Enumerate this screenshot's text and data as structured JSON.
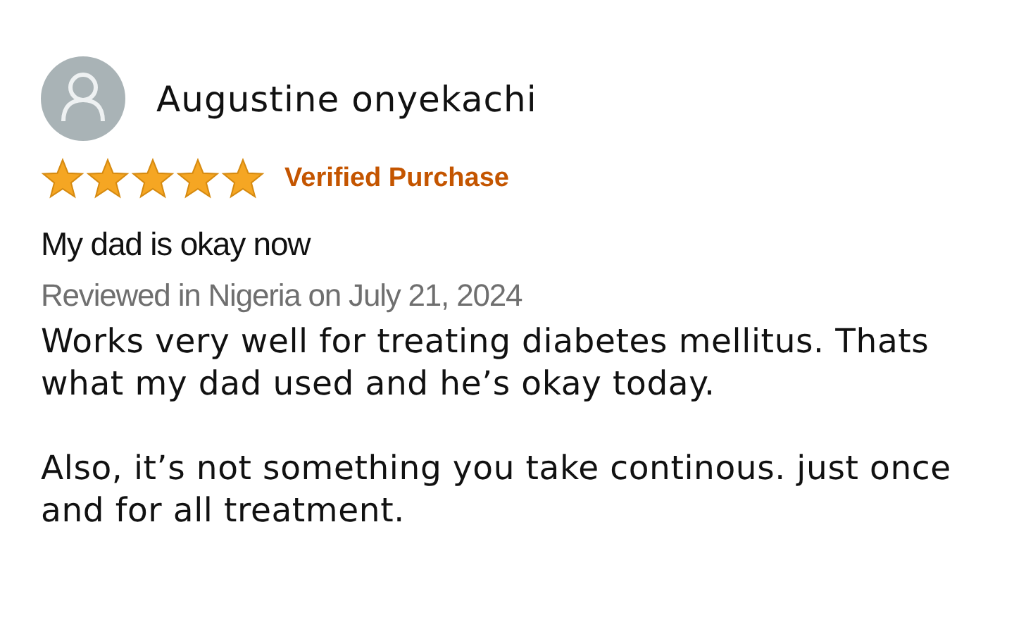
{
  "review": {
    "reviewer": "Augustine onyekachi",
    "stars": 5,
    "badge": "Verified Purchase",
    "title": "My dad is okay now",
    "meta": "Reviewed in Nigeria on July 21, 2024",
    "paragraphs": [
      "Works very well for treating diabetes mellitus. Thats what my dad used and he’s okay today.",
      "Also, it’s not something you take continous. just once and for all treatment."
    ]
  }
}
